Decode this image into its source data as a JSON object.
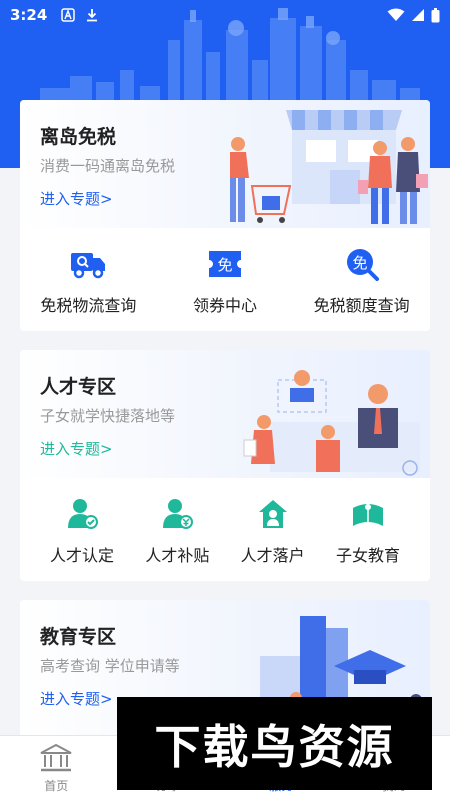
{
  "status_bar": {
    "time": "3:24",
    "icons_left": [
      "font-a-icon",
      "download-icon"
    ],
    "icons_right": [
      "wifi-icon",
      "signal-icon",
      "battery-icon"
    ]
  },
  "colors": {
    "primary": "#1f5ff2",
    "teal": "#1fb89a",
    "text": "#222222",
    "muted": "#999999"
  },
  "duty_free": {
    "title": "离岛免税",
    "subtitle": "消费一码通离岛免税",
    "link": "进入专题>",
    "actions": [
      {
        "label": "免税物流查询",
        "icon": "truck-icon"
      },
      {
        "label": "领券中心",
        "icon": "coupon-icon",
        "glyph": "免"
      },
      {
        "label": "免税额度查询",
        "icon": "search-quota-icon",
        "glyph": "免"
      }
    ]
  },
  "talent": {
    "title": "人才专区",
    "subtitle": "子女就学快捷落地等",
    "link": "进入专题>",
    "actions": [
      {
        "label": "人才认定",
        "icon": "person-check-icon"
      },
      {
        "label": "人才补贴",
        "icon": "person-yen-icon"
      },
      {
        "label": "人才落户",
        "icon": "house-person-icon"
      },
      {
        "label": "子女教育",
        "icon": "book-person-icon"
      }
    ]
  },
  "education": {
    "title": "教育专区",
    "subtitle": "高考查询 学位申请等",
    "link": "进入专题>"
  },
  "tabbar": {
    "tabs": [
      {
        "label": "首页",
        "icon": "home-icon"
      },
      {
        "label": "办事",
        "icon": "task-icon"
      },
      {
        "label": "服务",
        "icon": "service-icon"
      },
      {
        "label": "我的",
        "icon": "user-icon"
      }
    ],
    "active_index": 2
  },
  "watermark": {
    "text": "下载鸟资源"
  }
}
